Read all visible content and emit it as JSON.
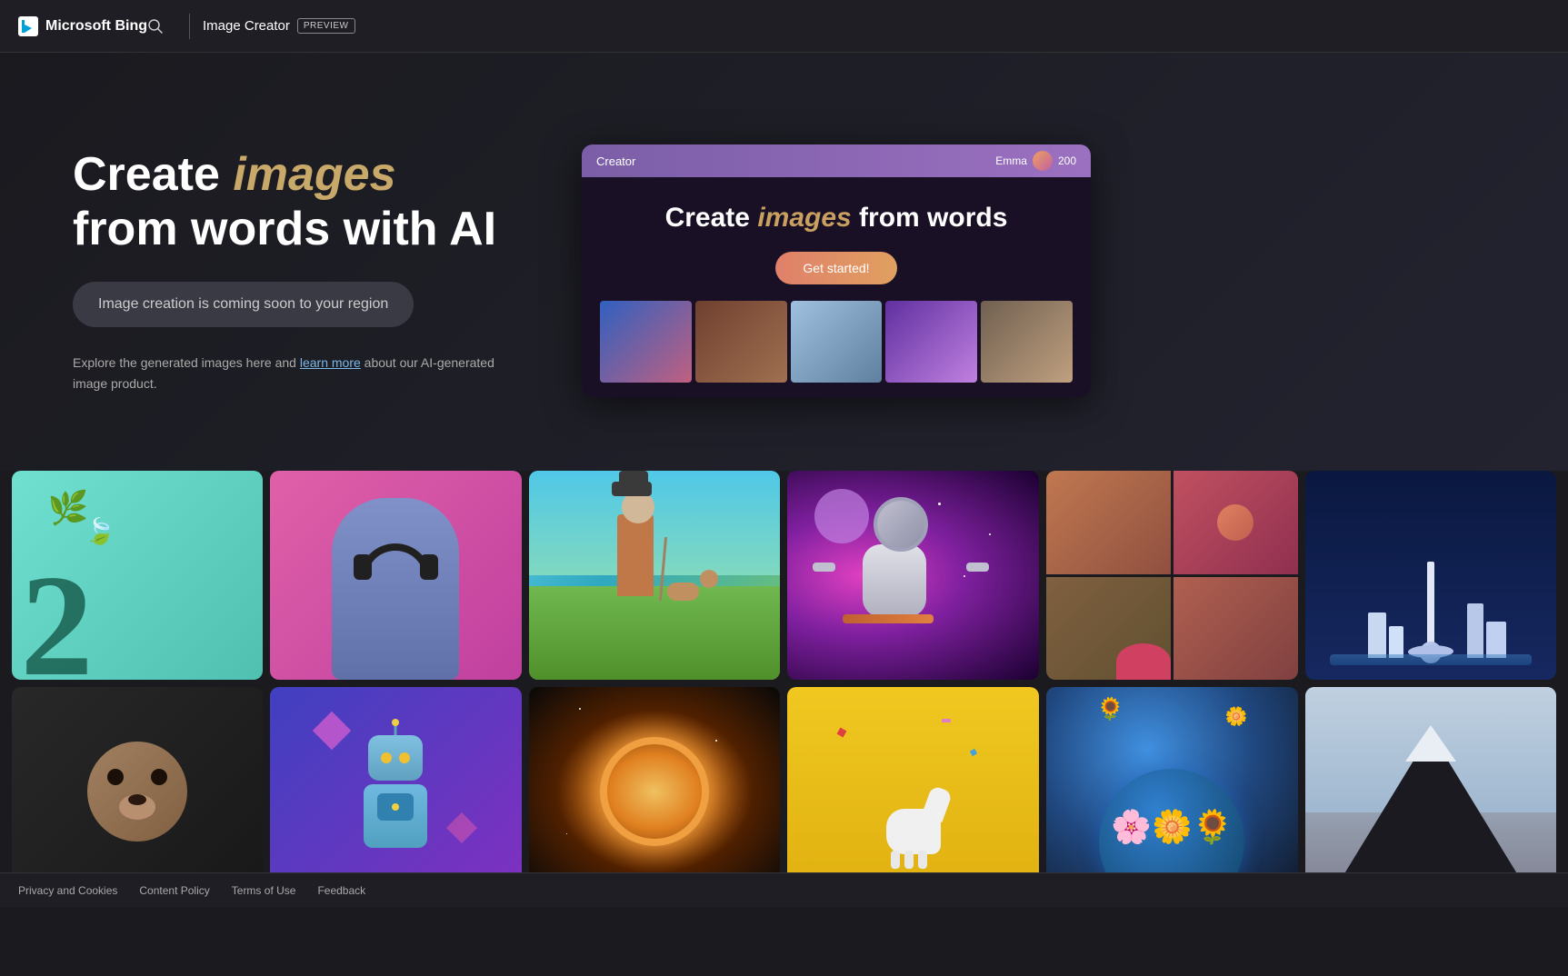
{
  "header": {
    "bing_label": "Microsoft Bing",
    "app_title": "Image Creator",
    "preview_badge": "PREVIEW"
  },
  "hero": {
    "title_part1": "Create ",
    "title_italic": "images",
    "title_part2": " from words with AI",
    "coming_soon_text": "Image creation is coming soon to your region",
    "description_part1": "Explore the generated images here and ",
    "description_link": "learn more",
    "description_part2": " about our AI-generated image product.",
    "preview_window": {
      "bar_title": "Creator",
      "user_name": "Emma",
      "user_credits": "200",
      "create_title_part1": "Create ",
      "create_italic": "images",
      "create_title_part2": "from words",
      "get_started_label": "Get started!"
    }
  },
  "gallery": {
    "row1": [
      {
        "id": "gi-1",
        "alt": "Number 2 with leaves on teal background"
      },
      {
        "id": "gi-2",
        "alt": "Classical statue with headphones on pink background"
      },
      {
        "id": "gi-3",
        "alt": "Old man walking dog illustration"
      },
      {
        "id": "gi-4",
        "alt": "Astronaut skateboarding in space"
      },
      {
        "id": "gi-5",
        "alt": "4-panel portrait collage"
      },
      {
        "id": "gi-6",
        "alt": "Isometric city skyline"
      }
    ],
    "row2": [
      {
        "id": "gi-7",
        "alt": "Pug dog portrait"
      },
      {
        "id": "gi-8",
        "alt": "Cute robot character"
      },
      {
        "id": "gi-9",
        "alt": "Space portal light"
      },
      {
        "id": "gi-10",
        "alt": "White horse on yellow background"
      },
      {
        "id": "gi-11",
        "alt": "Flower globe earth"
      },
      {
        "id": "gi-12",
        "alt": "Triangular mountain landscape"
      }
    ]
  },
  "footer": {
    "links": [
      {
        "label": "Privacy and Cookies",
        "id": "privacy"
      },
      {
        "label": "Content Policy",
        "id": "content-policy"
      },
      {
        "label": "Terms of Use",
        "id": "terms"
      },
      {
        "label": "Feedback",
        "id": "feedback-footer"
      }
    ]
  },
  "feedback_button": {
    "label": "Feedback"
  }
}
